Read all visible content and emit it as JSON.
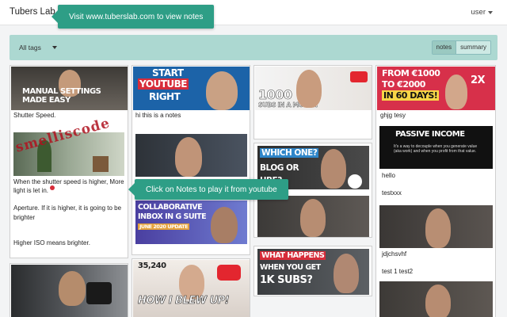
{
  "app": {
    "brand": "Tubers Lab",
    "user_label": "user"
  },
  "tooltips": {
    "top": "Visit www.tuberslab.com to view notes",
    "middle": "Click on Notes to play it from youtube"
  },
  "filter": {
    "tags_label": "All tags",
    "view_notes": "notes",
    "view_summary": "summary",
    "active_view": "notes"
  },
  "colors": {
    "accent": "#2e9e86",
    "filterbar": "#acd8d1",
    "red": "#d72c3a"
  },
  "column1": {
    "thumb1_text": "MANUAL SETTINGS MADE EASY",
    "note1": "Shutter Speed.",
    "stamp": "smelliscode",
    "note2_line1": "When the shutter speed is higher, More",
    "note2_line2": "light is let in.",
    "note2_line3": "Aperture. If it is higher, it is going to be",
    "note2_line4": "brighter",
    "note2_line5": "Higher ISO means brighter."
  },
  "column2": {
    "thumb1_line1": "START",
    "thumb1_line2": "YOUTUBE",
    "thumb1_line3": "RIGHT",
    "note1": "hi this is a notes",
    "thumb3_line1": "COLLABORATIVE",
    "thumb3_line2": "INBOX IN G SUITE",
    "thumb3_line3": "JUNE 2020 UPDATE",
    "thumb4_count": "35,240",
    "thumb4_text": "HOW I BLEW UP!"
  },
  "column3": {
    "thumb1_line1": "1000",
    "thumb1_line2": "SUBS IN A MONTH",
    "thumb2_line1": "WHICH ONE?",
    "thumb2_line2": "BLOG OR",
    "thumb2_line3": "UBE?",
    "thumb4_line1": "WHAT HAPPENS",
    "thumb4_line2": "WHEN YOU GET",
    "thumb4_line3": "1K SUBS?"
  },
  "column4": {
    "thumb1_line1": "FROM €1000",
    "thumb1_line2": "TO €2000",
    "thumb1_line3": "IN 60 DAYS!",
    "thumb1_badge": "2X",
    "note1": "ghjg tesy",
    "passive_title": "PASSIVE INCOME",
    "passive_body": "It's a way to decouple when you generate value (aka work) and when you profit from that value.",
    "note2": "hello",
    "note3": "testxxx",
    "note4": "jdjchsvhf",
    "note5": "test 1 test2"
  }
}
